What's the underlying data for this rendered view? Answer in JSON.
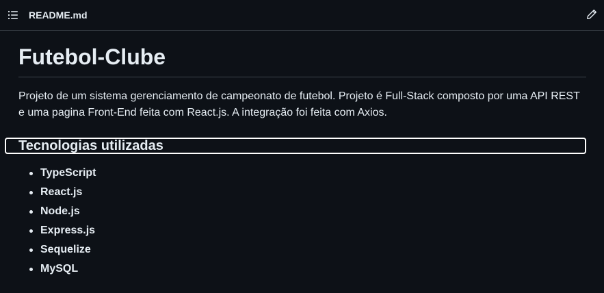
{
  "header": {
    "toc_icon": "list-unordered-icon",
    "filename": "README.md",
    "edit_icon": "pencil-icon"
  },
  "readme": {
    "title": "Futebol-Clube",
    "intro": "Projeto de um sistema gerenciamento de campeonato de futebol. Projeto é Full-Stack composto por uma API REST e uma pagina Front-End feita com React.js. A integração foi feita com Axios.",
    "tech_heading": "Tecnologias utilizadas",
    "technologies": [
      "TypeScript",
      "React.js",
      "Node.js",
      "Express.js",
      "Sequelize",
      "MySQL"
    ]
  },
  "colors": {
    "background": "#0d1117",
    "text": "#e6edf3",
    "border": "#30363d"
  }
}
